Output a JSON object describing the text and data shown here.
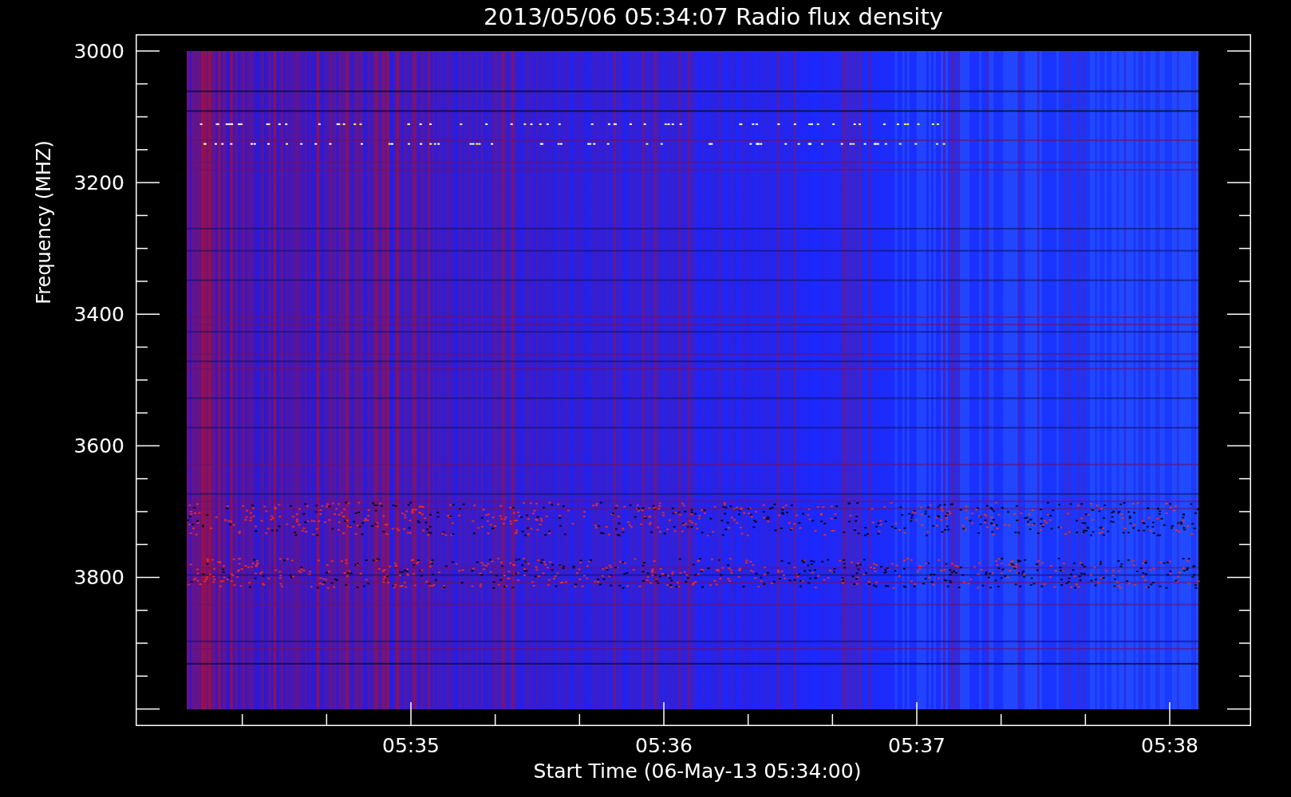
{
  "title": "2013/05/06 05:34:07 Radio flux density",
  "plot": {
    "ylabel": "Frequency (MHZ)",
    "xlabel": "Start Time (06-May-13 05:34:00)",
    "y_tick_labels": [
      "3000",
      "3200",
      "3400",
      "3600",
      "3800"
    ],
    "x_tick_labels": [
      "05:35",
      "05:36",
      "05:37",
      "05:38"
    ]
  }
}
